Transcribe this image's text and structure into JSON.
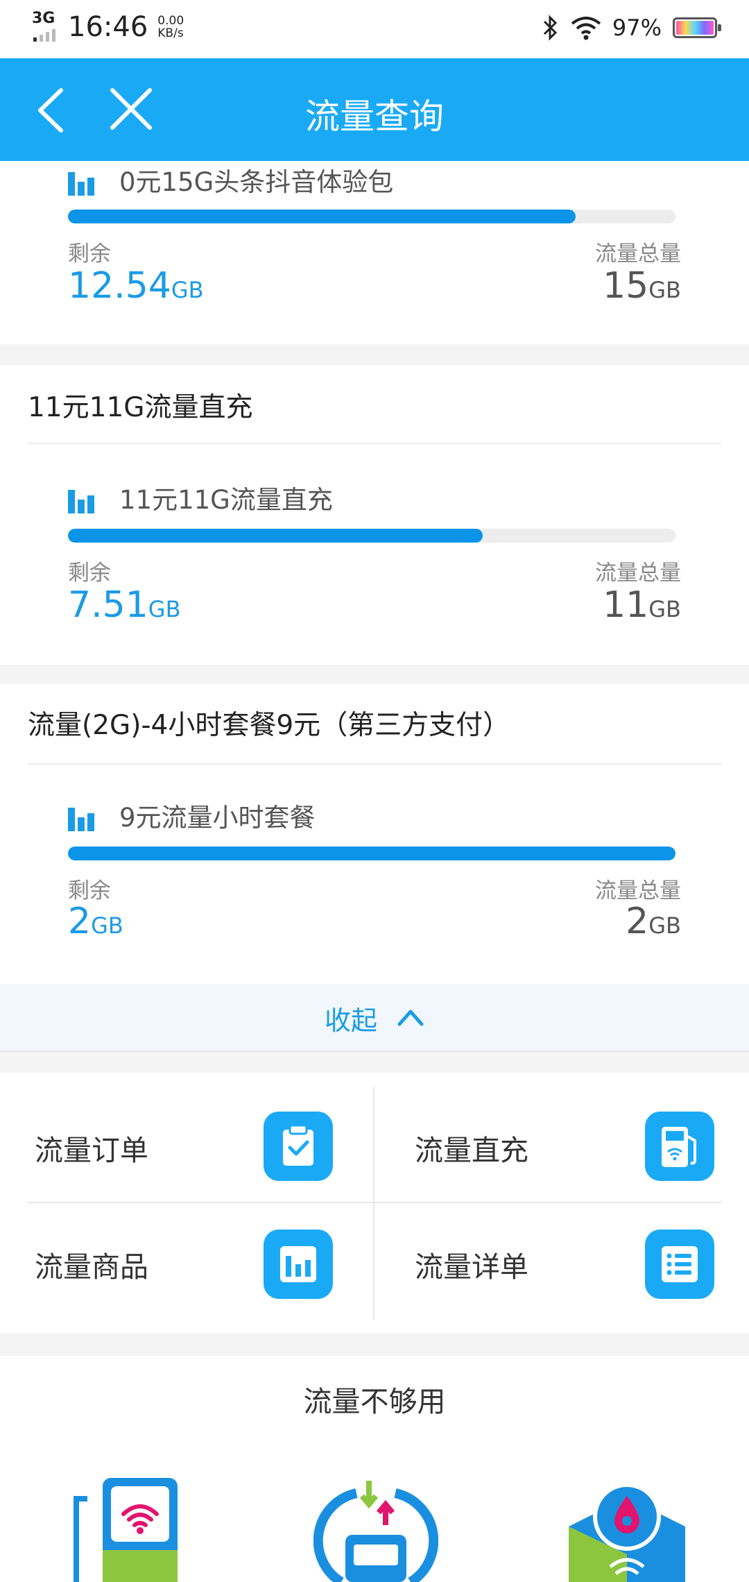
{
  "status_bar": {
    "network": "3G",
    "time": "16:46",
    "speed_value": "0.00",
    "speed_unit": "KB/s",
    "battery": "97%"
  },
  "header": {
    "title": "流量查询"
  },
  "packages": [
    {
      "title": "",
      "items": [
        {
          "name": "0元15G头条抖音体验包",
          "remaining_label": "剩余",
          "remaining": "12.54",
          "unit": "GB",
          "total_label": "流量总量",
          "total": "15",
          "ratio": 0.836
        }
      ]
    },
    {
      "title": "11元11G流量直充",
      "items": [
        {
          "name": "11元11G流量直充",
          "remaining_label": "剩余",
          "remaining": "7.51",
          "unit": "GB",
          "total_label": "流量总量",
          "total": "11",
          "ratio": 0.683
        }
      ]
    },
    {
      "title": "流量(2G)-4小时套餐9元（第三方支付）",
      "items": [
        {
          "name": "9元流量小时套餐",
          "remaining_label": "剩余",
          "remaining": "2",
          "unit": "GB",
          "total_label": "流量总量",
          "total": "2",
          "ratio": 1.0
        }
      ]
    }
  ],
  "collapse": {
    "label": "收起"
  },
  "menu": [
    {
      "label": "流量订单",
      "icon": "clipboard-check-icon"
    },
    {
      "label": "流量直充",
      "icon": "wifi-recharge-icon"
    },
    {
      "label": "流量商品",
      "icon": "bar-chart-icon"
    },
    {
      "label": "流量详单",
      "icon": "list-icon"
    }
  ],
  "not_enough": {
    "title": "流量不够用"
  },
  "colors": {
    "primary": "#1aaaf5",
    "progress": "#0b94e8",
    "accent_text": "#1a9be6"
  }
}
